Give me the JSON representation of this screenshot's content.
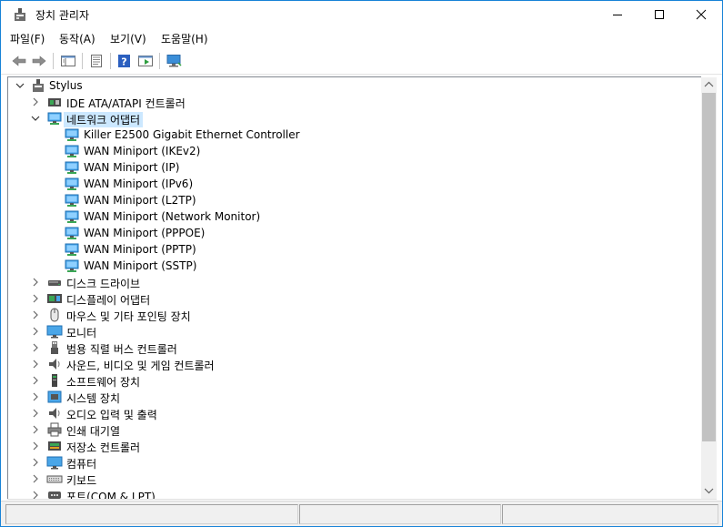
{
  "window": {
    "title": "장치 관리자",
    "accent": "#1883d7",
    "controls": [
      "minimize",
      "maximize",
      "close"
    ]
  },
  "menu": {
    "items": [
      {
        "label": "파일(F)"
      },
      {
        "label": "동작(A)"
      },
      {
        "label": "보기(V)"
      },
      {
        "label": "도움말(H)"
      }
    ]
  },
  "toolbar": {
    "buttons": [
      "back-arrow-icon",
      "forward-arrow-icon",
      "show-hide-tree-icon",
      "properties-icon",
      "help-icon",
      "run-icon",
      "monitor-icon"
    ]
  },
  "tree": {
    "root": {
      "label": "Stylus",
      "expanded": true
    },
    "items": [
      {
        "label": "IDE ATA/ATAPI 컨트롤러",
        "icon": "ide-controller-icon",
        "expanded": false,
        "level": 1
      },
      {
        "label": "네트워크 어댑터",
        "icon": "network-adapter-icon",
        "expanded": true,
        "selected": true,
        "level": 1
      },
      {
        "label": "Killer E2500 Gigabit Ethernet Controller",
        "icon": "network-adapter-icon",
        "level": 2
      },
      {
        "label": "WAN Miniport (IKEv2)",
        "icon": "network-adapter-icon",
        "level": 2
      },
      {
        "label": "WAN Miniport (IP)",
        "icon": "network-adapter-icon",
        "level": 2
      },
      {
        "label": "WAN Miniport (IPv6)",
        "icon": "network-adapter-icon",
        "level": 2
      },
      {
        "label": "WAN Miniport (L2TP)",
        "icon": "network-adapter-icon",
        "level": 2
      },
      {
        "label": "WAN Miniport (Network Monitor)",
        "icon": "network-adapter-icon",
        "level": 2
      },
      {
        "label": "WAN Miniport (PPPOE)",
        "icon": "network-adapter-icon",
        "level": 2
      },
      {
        "label": "WAN Miniport (PPTP)",
        "icon": "network-adapter-icon",
        "level": 2
      },
      {
        "label": "WAN Miniport (SSTP)",
        "icon": "network-adapter-icon",
        "level": 2
      },
      {
        "label": "디스크 드라이브",
        "icon": "disk-drive-icon",
        "expanded": false,
        "level": 1
      },
      {
        "label": "디스플레이 어댑터",
        "icon": "display-adapter-icon",
        "expanded": false,
        "level": 1
      },
      {
        "label": "마우스 및 기타 포인팅 장치",
        "icon": "mouse-icon",
        "expanded": false,
        "level": 1
      },
      {
        "label": "모니터",
        "icon": "monitor-icon",
        "expanded": false,
        "level": 1
      },
      {
        "label": "범용 직렬 버스 컨트롤러",
        "icon": "usb-icon",
        "expanded": false,
        "level": 1
      },
      {
        "label": "사운드, 비디오 및 게임 컨트롤러",
        "icon": "speaker-icon",
        "expanded": false,
        "level": 1
      },
      {
        "label": "소프트웨어 장치",
        "icon": "software-device-icon",
        "expanded": false,
        "level": 1
      },
      {
        "label": "시스템 장치",
        "icon": "system-device-icon",
        "expanded": false,
        "level": 1
      },
      {
        "label": "오디오 입력 및 출력",
        "icon": "speaker-icon",
        "expanded": false,
        "level": 1
      },
      {
        "label": "인쇄 대기열",
        "icon": "printer-icon",
        "expanded": false,
        "level": 1
      },
      {
        "label": "저장소 컨트롤러",
        "icon": "storage-controller-icon",
        "expanded": false,
        "level": 1
      },
      {
        "label": "컴퓨터",
        "icon": "computer-icon",
        "expanded": false,
        "level": 1
      },
      {
        "label": "키보드",
        "icon": "keyboard-icon",
        "expanded": false,
        "level": 1
      },
      {
        "label": "포트(COM & LPT)",
        "icon": "port-icon",
        "expanded": false,
        "level": 1
      }
    ]
  }
}
